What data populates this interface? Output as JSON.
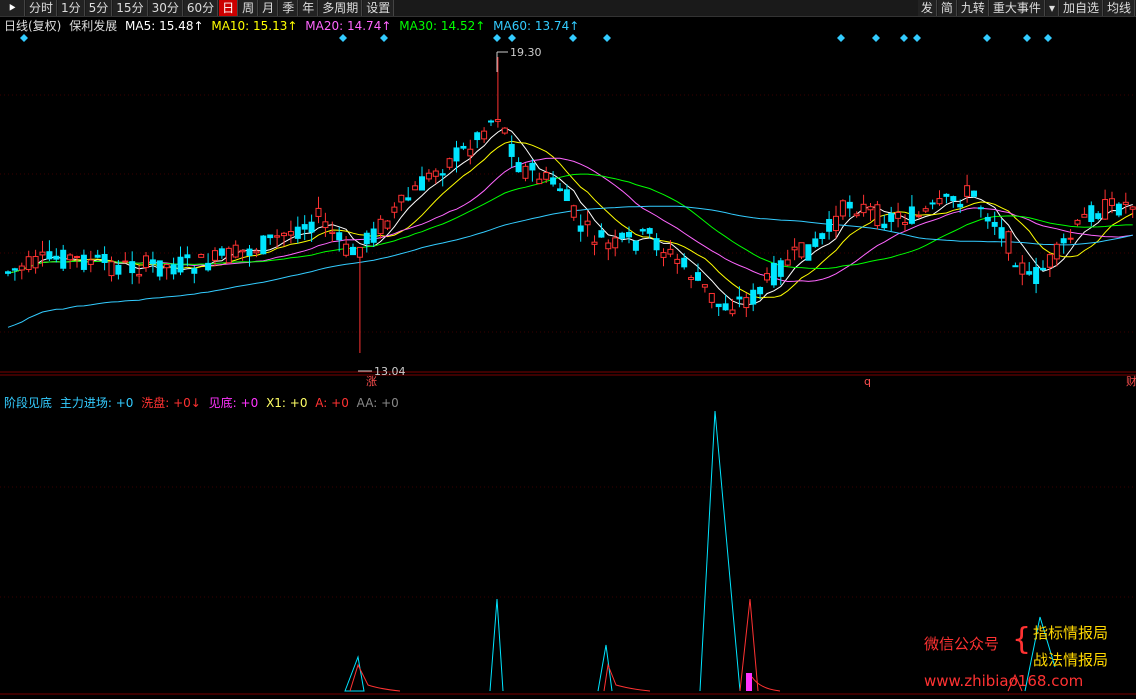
{
  "toolbar": {
    "back_icon": "⯈",
    "periods": [
      "分时",
      "1分",
      "5分",
      "15分",
      "30分",
      "60分",
      "日",
      "周",
      "月",
      "季",
      "年",
      "多周期",
      "设置"
    ],
    "active_period": "日",
    "right_items": [
      "发",
      "简",
      "九转",
      "重大事件",
      "▾",
      "加自选",
      "均线"
    ]
  },
  "main_info": {
    "type_label": "日线(复权)",
    "stock_name": "保利发展",
    "ma5": "MA5: 15.48↑",
    "ma10": "MA10: 15.13↑",
    "ma20": "MA20: 14.74↑",
    "ma30": "MA30: 14.52↑",
    "ma60": "MA60: 13.74↑"
  },
  "main_labels": {
    "high": "19.30",
    "low": "13.04",
    "mark_zhang": "涨",
    "mark_q": "q",
    "mark_cai": "财"
  },
  "indicator_info": {
    "name": "阶段见底",
    "zljc": "主力进场: +0",
    "xp": "洗盘: +0↓",
    "jd": "见底: +0",
    "x1": "X1: +0",
    "a": "A: +0",
    "aa": "AA: +0"
  },
  "watermark": {
    "wechat": "微信公众号",
    "brace": "{",
    "line1": "指标情报局",
    "line2": "战法情报局",
    "url": "www.zhibiao168.com"
  },
  "colors": {
    "up": "#ff3232",
    "down": "#00e5ff",
    "ma5": "#ffffff",
    "ma10": "#ffff00",
    "ma20": "#ff66ff",
    "ma30": "#00ff00",
    "ma60": "#33ccff"
  }
}
